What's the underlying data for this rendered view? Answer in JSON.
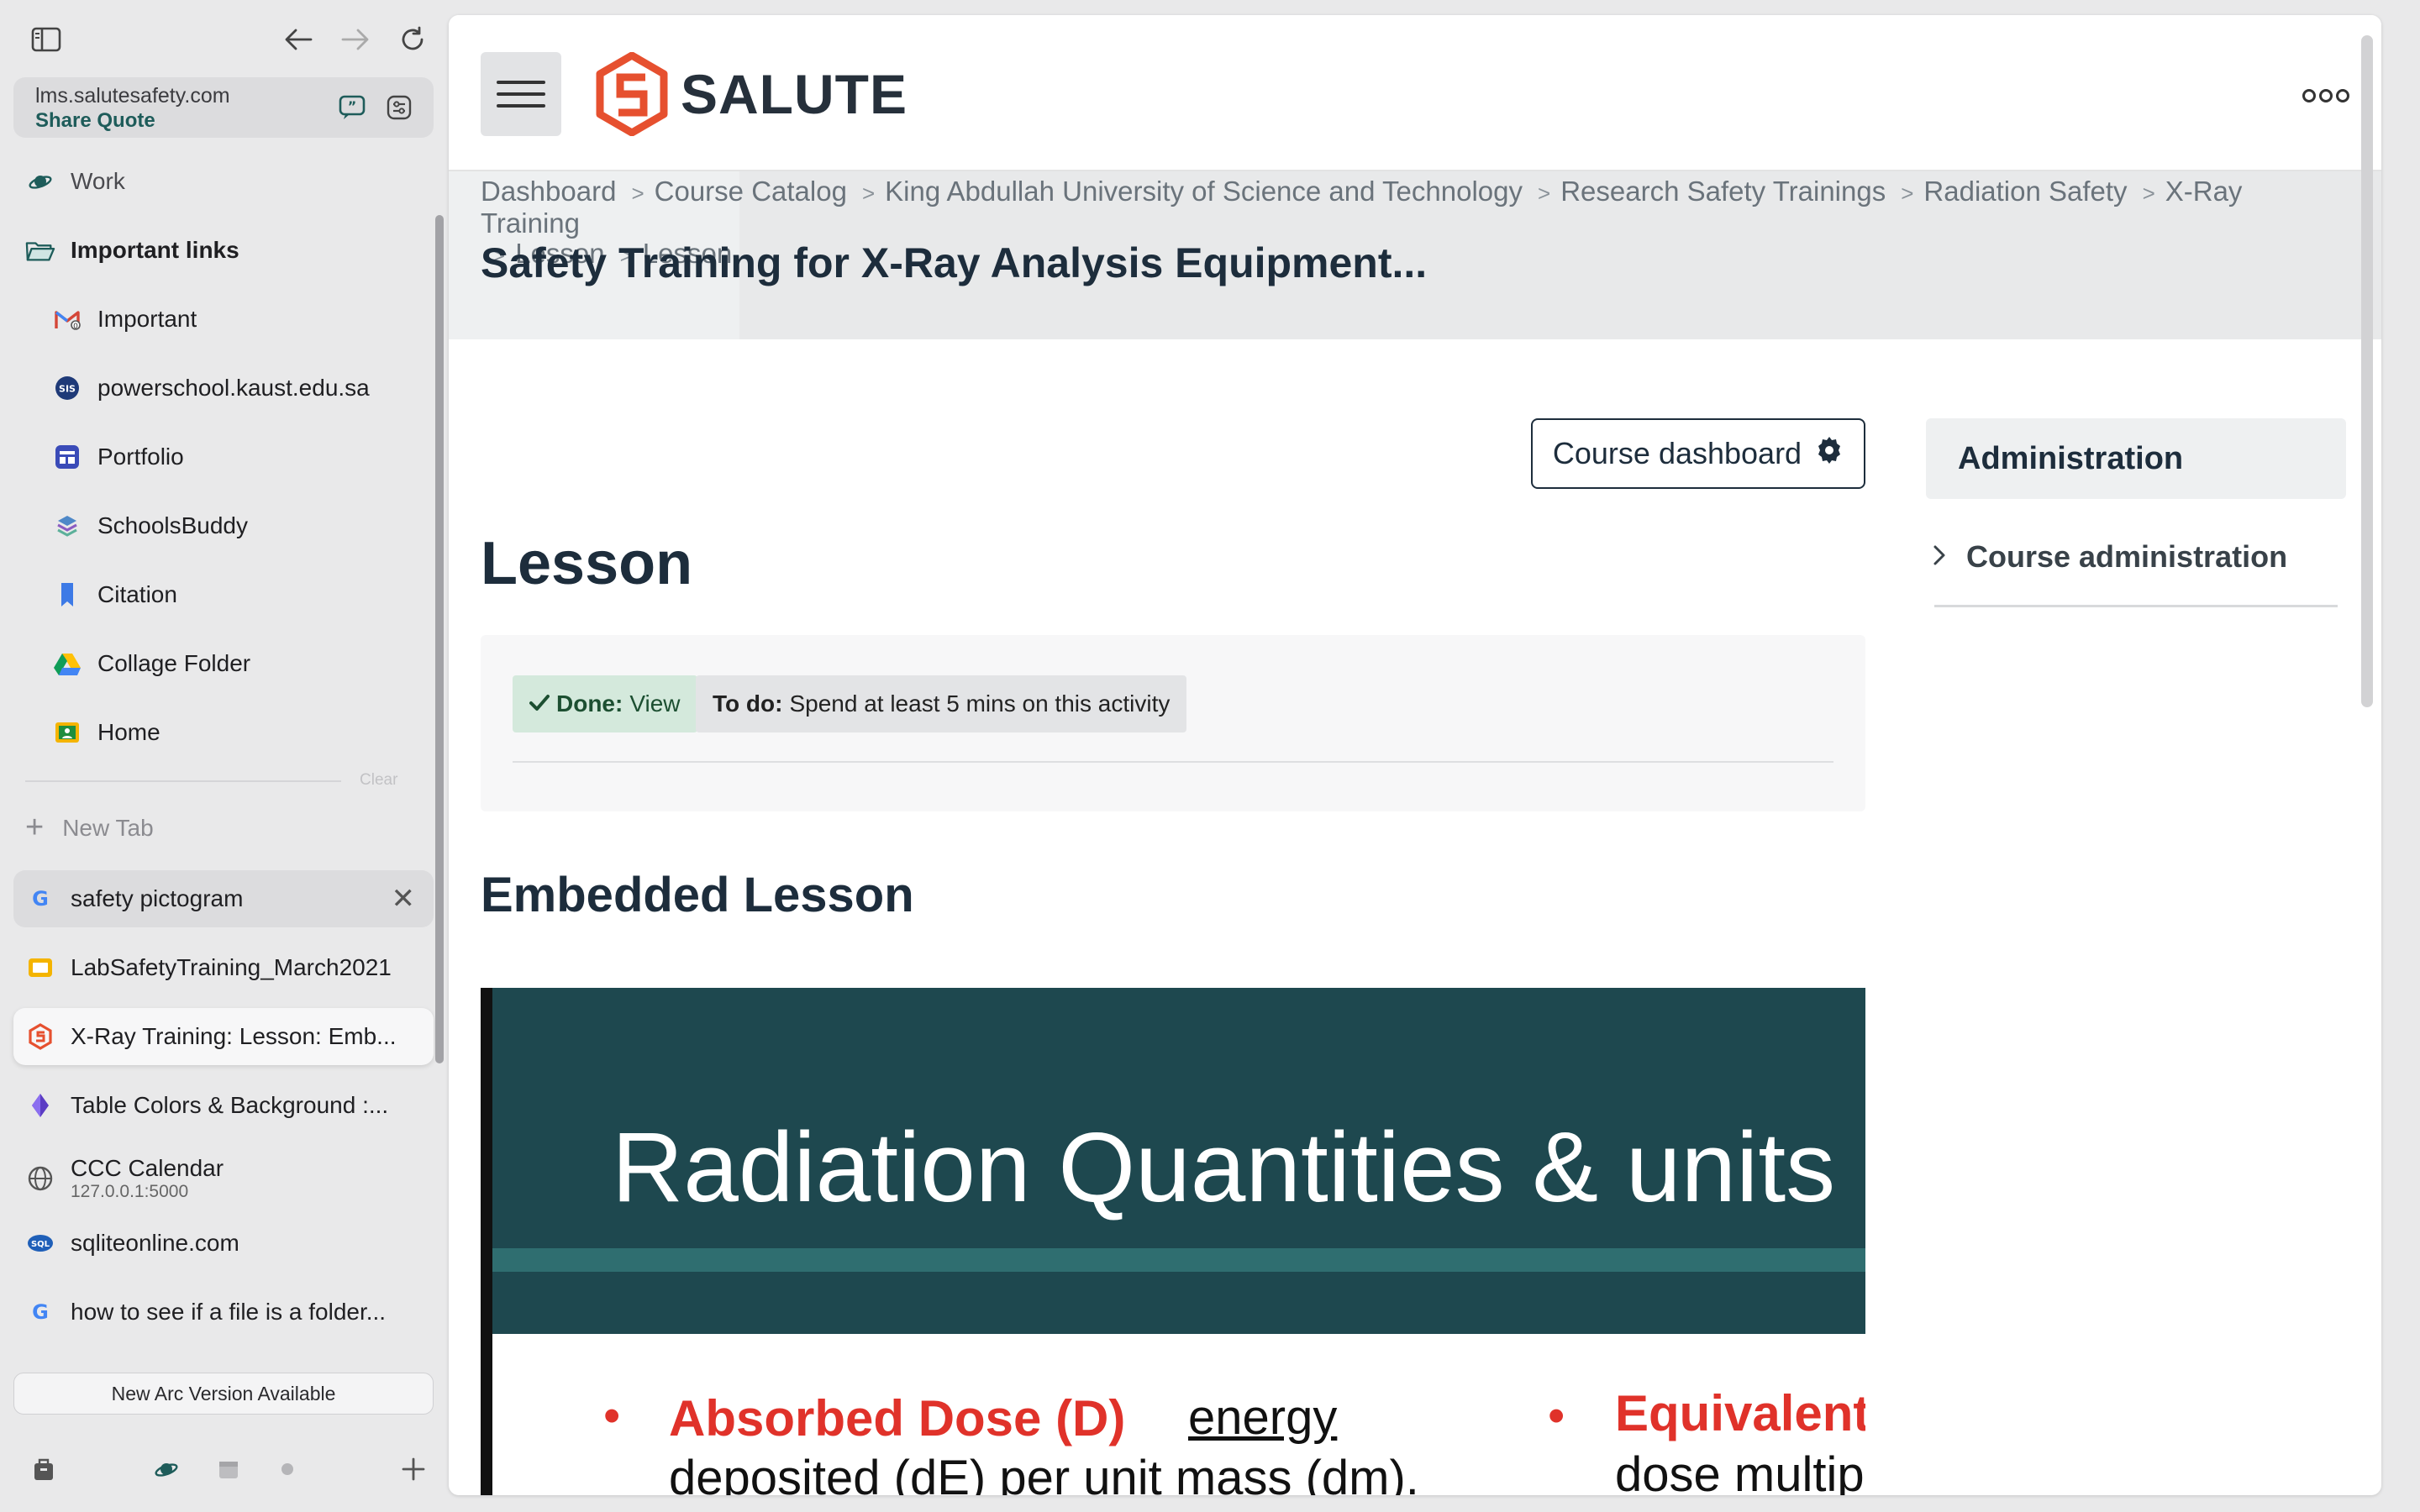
{
  "sidebar": {
    "url": {
      "host": "lms.salutesafety.com",
      "subtitle": "Share Quote"
    },
    "pinned": [
      {
        "label": "Work",
        "icon": "planet-icon"
      }
    ],
    "folder": {
      "label": "Important links",
      "icon": "folder-icon"
    },
    "folder_items": [
      {
        "label": "Important",
        "icon": "gmail-icon"
      },
      {
        "label": "powerschool.kaust.edu.sa",
        "icon": "sis-icon"
      },
      {
        "label": "Portfolio",
        "icon": "calendar-app-icon"
      },
      {
        "label": "SchoolsBuddy",
        "icon": "schoolsbuddy-icon"
      },
      {
        "label": "Citation",
        "icon": "bookmark-icon"
      },
      {
        "label": "Collage Folder",
        "icon": "google-drive-icon"
      },
      {
        "label": "Home",
        "icon": "classroom-icon"
      }
    ],
    "clear_label": "Clear",
    "new_tab_label": "New Tab",
    "tabs": [
      {
        "label": "safety pictogram",
        "icon": "google-icon"
      },
      {
        "label": "LabSafetyTraining_March2021",
        "icon": "slides-icon"
      },
      {
        "label": "X-Ray Training: Lesson: Emb...",
        "icon": "salute-icon"
      },
      {
        "label": "Table Colors & Background :...",
        "icon": "tailwind-icon"
      },
      {
        "label": "CCC Calendar",
        "sub": "127.0.0.1:5000",
        "icon": "globe-icon"
      },
      {
        "label": "sqliteonline.com",
        "icon": "sql-icon"
      },
      {
        "label": "how to see if a file is a folder...",
        "icon": "google-icon"
      }
    ],
    "update_label": "New Arc Version Available"
  },
  "page": {
    "logo_text": "SALUTE",
    "breadcrumbs": [
      "Dashboard",
      "Course Catalog",
      "King Abdullah University of Science and Technology",
      "Research Safety Trainings",
      "Radiation Safety",
      "X-Ray Training",
      "Lesson",
      "Lesson"
    ],
    "title": "Safety Training for X-Ray Analysis Equipment...",
    "course_dashboard_label": "Course dashboard",
    "lesson_heading": "Lesson",
    "done_label": "Done:",
    "done_value": "View",
    "todo_label": "To do:",
    "todo_value": "Spend at least 5 mins on this activity",
    "embedded_heading": "Embedded Lesson",
    "slide": {
      "title": "Radiation Quantities & units",
      "bullet_1_title": "Absorbed Dose (D)",
      "bullet_1_word": "energy",
      "bullet_1_text": "deposited (dE) per unit mass (dm).",
      "bullet_2_title": "Equivalent",
      "bullet_2_text": "dose multip"
    },
    "admin": {
      "heading": "Administration",
      "item": "Course administration"
    }
  },
  "colors": {
    "accent": "#e6502f",
    "brand_dark": "#26303b",
    "slide_band": "#1e484f",
    "slide_red": "#e0322a",
    "done_bg": "#d4e9dc"
  }
}
